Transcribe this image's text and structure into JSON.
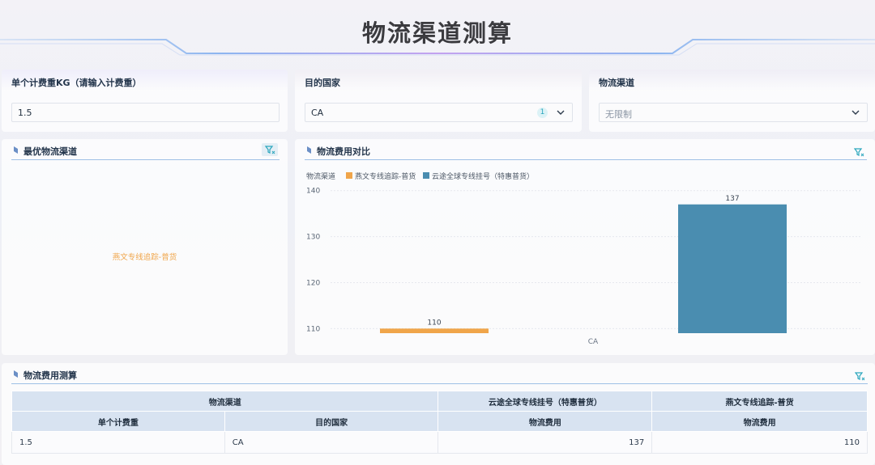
{
  "header": {
    "title": "物流渠道测算"
  },
  "inputs": {
    "weight": {
      "label": "单个计费重KG（请输入计费重）",
      "value": "1.5"
    },
    "country": {
      "label": "目的国家",
      "value": "CA",
      "selected_count": "1"
    },
    "channel": {
      "label": "物流渠道",
      "placeholder": "无限制"
    }
  },
  "best_channel": {
    "title": "最优物流渠道",
    "value": "燕文专线追踪-普货"
  },
  "compare_chart": {
    "title": "物流费用对比",
    "legend_title": "物流渠道"
  },
  "chart_data": {
    "type": "bar",
    "categories": [
      "CA"
    ],
    "series": [
      {
        "name": "燕文专线追踪-普货",
        "values": [
          110
        ],
        "color": "#f0a54a"
      },
      {
        "name": "云途全球专线挂号（特惠普货）",
        "values": [
          137
        ],
        "color": "#4a8db0"
      }
    ],
    "yticks": [
      "110",
      "120",
      "130",
      "140"
    ],
    "ylim": [
      109,
      141
    ],
    "grid": true,
    "legend": "top-left"
  },
  "calc_table": {
    "title": "物流费用测算",
    "group_headers": [
      "物流渠道",
      "云途全球专线挂号（特惠普货）",
      "燕文专线追踪-普货"
    ],
    "headers": [
      "单个计费重",
      "目的国家",
      "物流费用",
      "物流费用"
    ],
    "rows": [
      [
        "1.5",
        "CA",
        "137",
        "110"
      ]
    ]
  },
  "colors": {
    "accent_line": "#9ec0e6",
    "header_gradient": [
      "#a8c4ee",
      "#c9a6ee"
    ]
  }
}
